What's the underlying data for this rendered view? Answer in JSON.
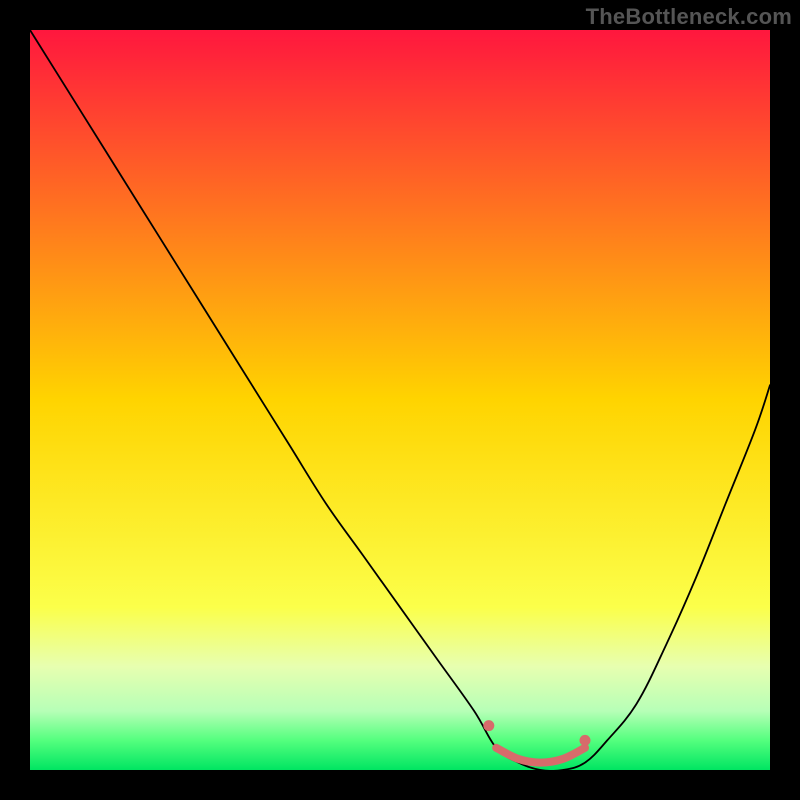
{
  "watermark": "TheBottleneck.com",
  "chart_data": {
    "type": "line",
    "title": "",
    "xlabel": "",
    "ylabel": "",
    "xlim": [
      0,
      100
    ],
    "ylim": [
      0,
      100
    ],
    "background_gradient": {
      "stops": [
        {
          "offset": 0.0,
          "color": "#ff173e"
        },
        {
          "offset": 0.5,
          "color": "#ffd400"
        },
        {
          "offset": 0.78,
          "color": "#fbff4a"
        },
        {
          "offset": 0.86,
          "color": "#e7ffb0"
        },
        {
          "offset": 0.92,
          "color": "#b7ffb7"
        },
        {
          "offset": 0.96,
          "color": "#54ff7e"
        },
        {
          "offset": 1.0,
          "color": "#00e562"
        }
      ]
    },
    "series": [
      {
        "name": "bottleneck-curve",
        "stroke": "#000000",
        "stroke_width": 1.8,
        "x": [
          0,
          5,
          10,
          15,
          20,
          25,
          30,
          35,
          40,
          45,
          50,
          55,
          60,
          63,
          66,
          69,
          72,
          75,
          78,
          82,
          86,
          90,
          94,
          98,
          100
        ],
        "y": [
          100,
          92,
          84,
          76,
          68,
          60,
          52,
          44,
          36,
          29,
          22,
          15,
          8,
          3,
          1,
          0,
          0,
          1,
          4,
          9,
          17,
          26,
          36,
          46,
          52
        ]
      }
    ],
    "markers": [
      {
        "name": "flat-region-left",
        "x": 62,
        "y": 6,
        "r": 5.5,
        "fill": "#d76b6b"
      },
      {
        "name": "flat-region-right",
        "x": 75,
        "y": 4,
        "r": 5.5,
        "fill": "#d76b6b"
      }
    ],
    "flat_segment": {
      "stroke": "#d76b6b",
      "stroke_width": 8,
      "x": [
        63,
        66,
        69,
        72,
        75
      ],
      "y": [
        3,
        1.5,
        1,
        1.5,
        3
      ]
    }
  }
}
